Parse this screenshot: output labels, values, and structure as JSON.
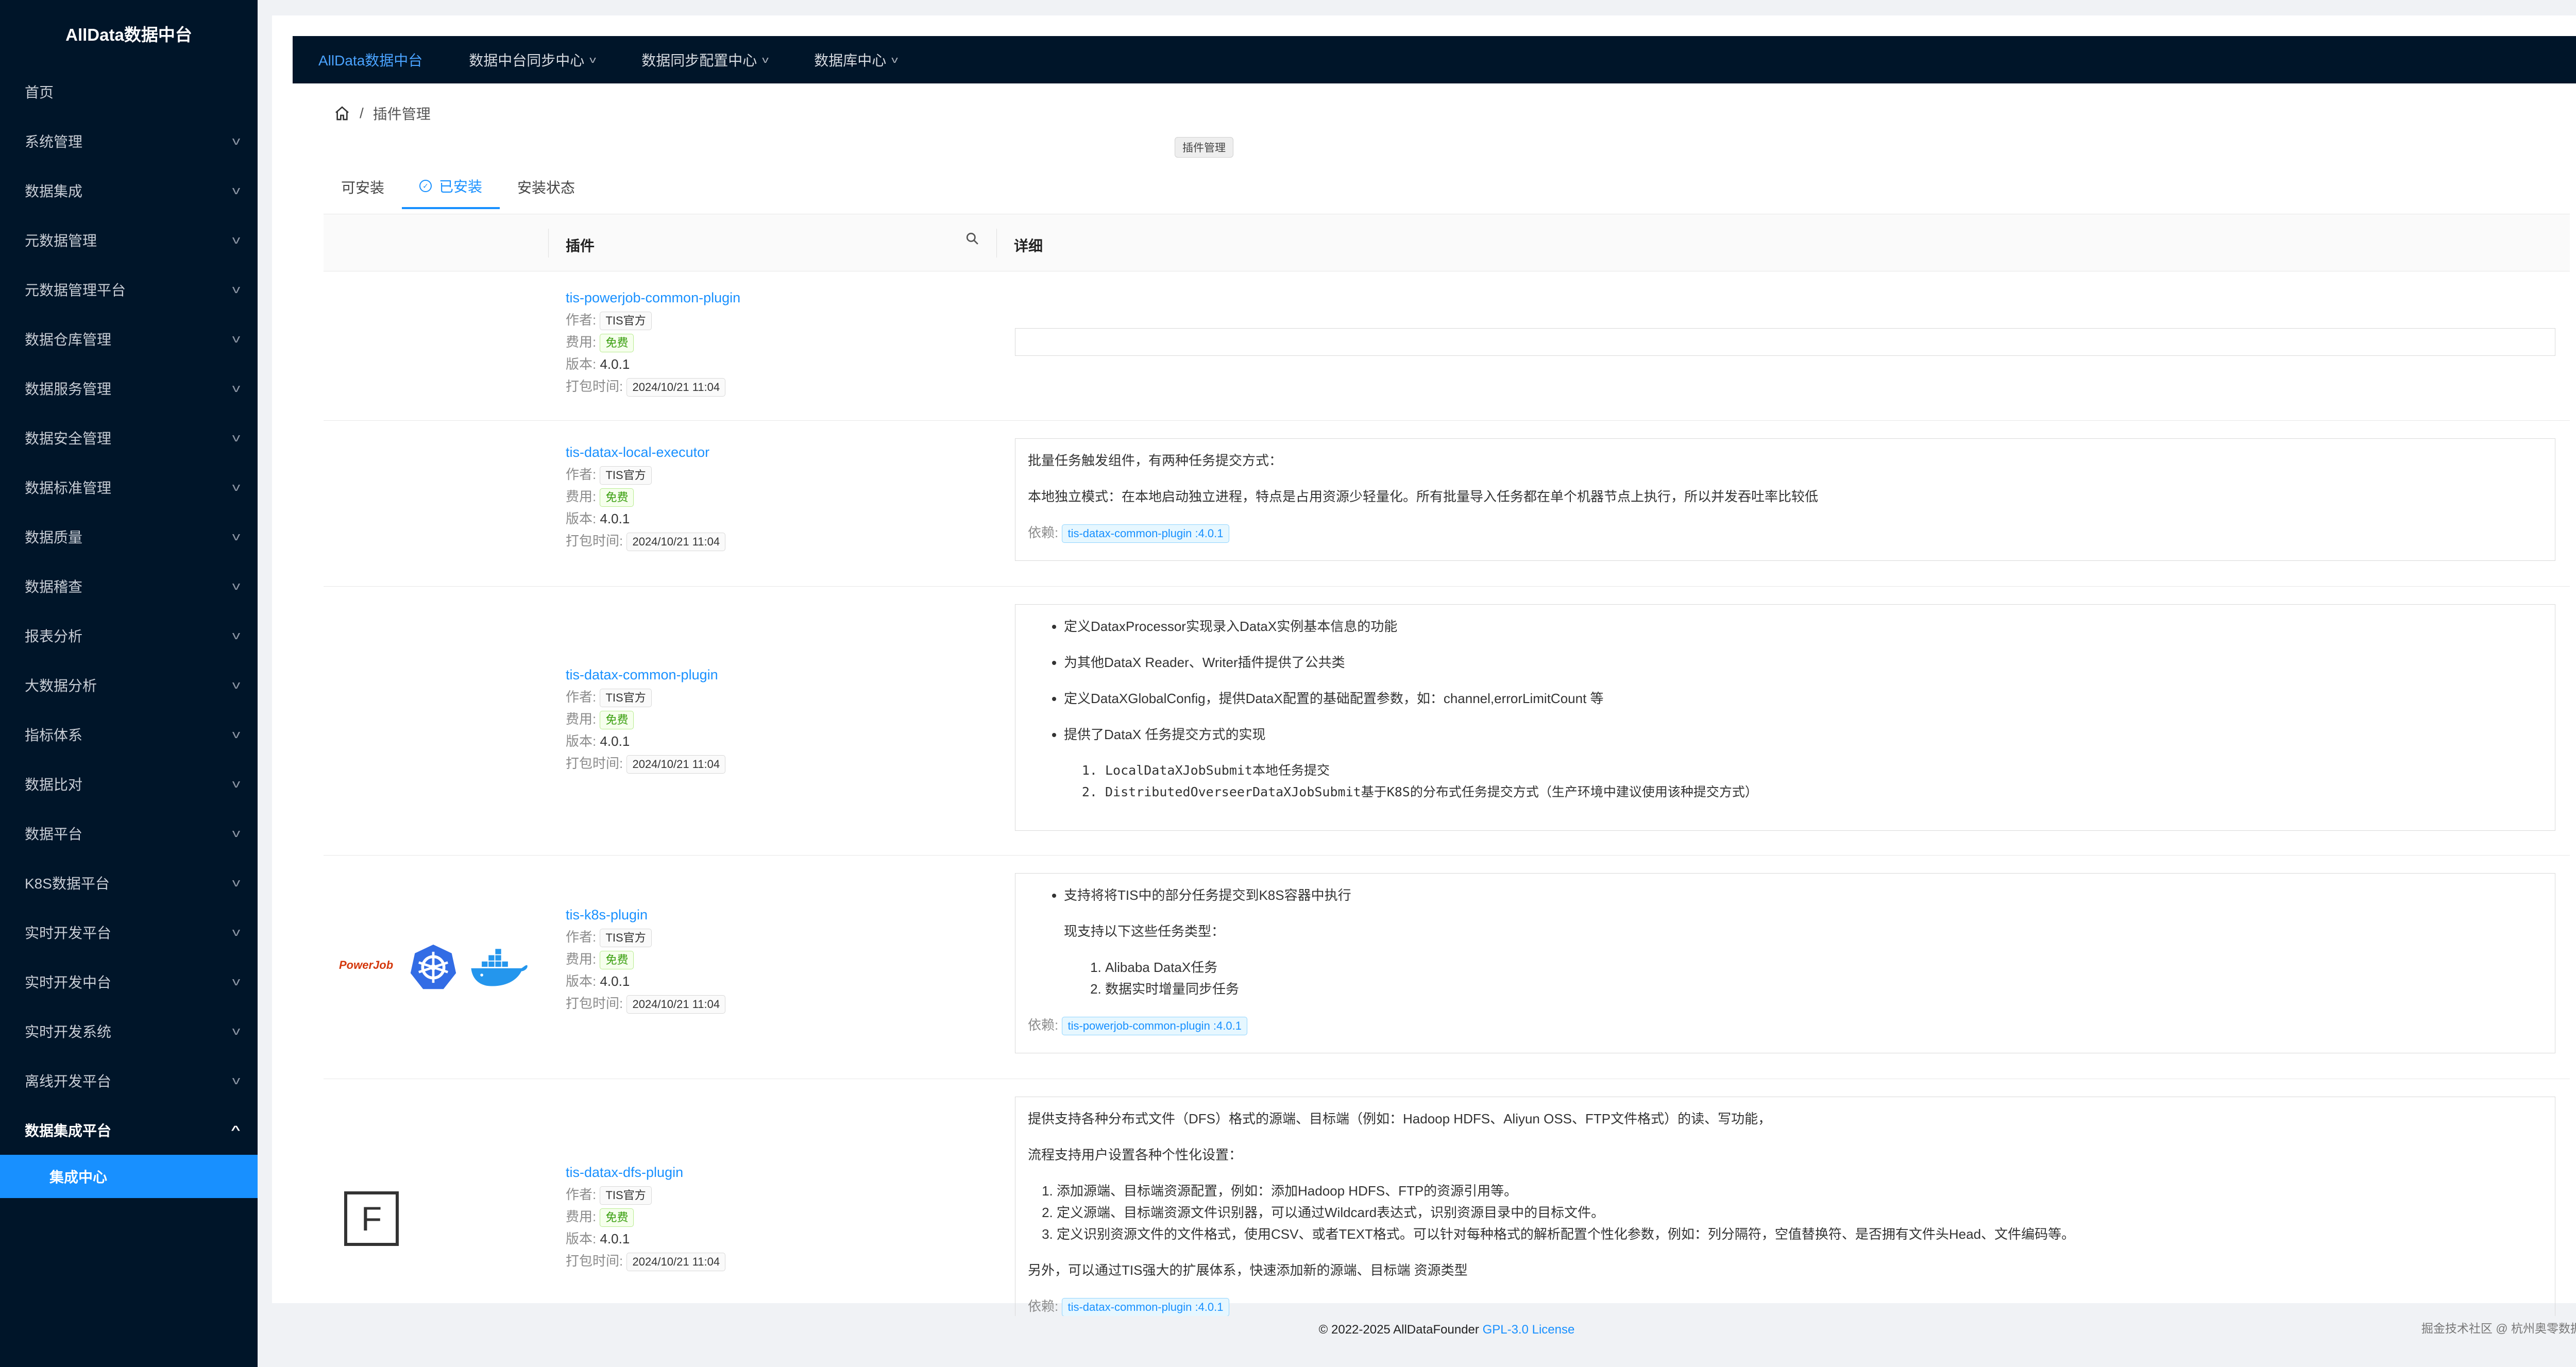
{
  "app_title": "AllData数据中台",
  "sidebar": {
    "items": [
      {
        "label": "首页",
        "chevron": false
      },
      {
        "label": "系统管理",
        "chevron": true
      },
      {
        "label": "数据集成",
        "chevron": true
      },
      {
        "label": "元数据管理",
        "chevron": true
      },
      {
        "label": "元数据管理平台",
        "chevron": true
      },
      {
        "label": "数据仓库管理",
        "chevron": true
      },
      {
        "label": "数据服务管理",
        "chevron": true
      },
      {
        "label": "数据安全管理",
        "chevron": true
      },
      {
        "label": "数据标准管理",
        "chevron": true
      },
      {
        "label": "数据质量",
        "chevron": true
      },
      {
        "label": "数据稽查",
        "chevron": true
      },
      {
        "label": "报表分析",
        "chevron": true
      },
      {
        "label": "大数据分析",
        "chevron": true
      },
      {
        "label": "指标体系",
        "chevron": true
      },
      {
        "label": "数据比对",
        "chevron": true
      },
      {
        "label": "数据平台",
        "chevron": true
      },
      {
        "label": "K8S数据平台",
        "chevron": true
      },
      {
        "label": "实时开发平台",
        "chevron": true
      },
      {
        "label": "实时开发中台",
        "chevron": true
      },
      {
        "label": "实时开发系统",
        "chevron": true
      },
      {
        "label": "离线开发平台",
        "chevron": true
      }
    ],
    "open_item": "数据集成平台",
    "active_subitem": "集成中心"
  },
  "topnav": {
    "items": [
      "AllData数据中台",
      "数据中台同步中心",
      "数据同步配置中心",
      "数据库中心"
    ]
  },
  "breadcrumb": {
    "current": "插件管理"
  },
  "tooltip": "插件管理",
  "tabs": [
    "可安装",
    "已安装",
    "安装状态"
  ],
  "table": {
    "col_plugin": "插件",
    "col_detail": "详细",
    "labels": {
      "author": "作者:",
      "fee": "费用:",
      "version": "版本:",
      "packaged": "打包时间:",
      "dependency": "依赖:"
    },
    "rows": [
      {
        "name": "tis-powerjob-common-plugin",
        "author": "TIS官方",
        "fee": "免费",
        "version": "4.0.1",
        "time": "2024/10/21 11:04"
      },
      {
        "name": "tis-datax-local-executor",
        "author": "TIS官方",
        "fee": "免费",
        "version": "4.0.1",
        "time": "2024/10/21 11:04",
        "detail": {
          "p1": "批量任务触发组件，有两种任务提交方式：",
          "p2": "本地独立模式：在本地启动独立进程，特点是占用资源少轻量化。所有批量导入任务都在单个机器节点上执行，所以并发吞吐率比较低",
          "dep": "tis-datax-common-plugin :4.0.1"
        }
      },
      {
        "name": "tis-datax-common-plugin",
        "author": "TIS官方",
        "fee": "免费",
        "version": "4.0.1",
        "time": "2024/10/21 11:04",
        "detail": {
          "bullets": [
            "定义DataxProcessor实现录入DataX实例基本信息的功能",
            "为其他DataX Reader、Writer插件提供了公共类",
            "定义DataXGlobalConfig，提供DataX配置的基础配置参数，如：channel,errorLimitCount 等",
            "提供了DataX 任务提交方式的实现"
          ],
          "ol": [
            "LocalDataXJobSubmit本地任务提交",
            "DistributedOverseerDataXJobSubmit基于K8S的分布式任务提交方式（生产环境中建议使用该种提交方式）"
          ]
        }
      },
      {
        "name": "tis-k8s-plugin",
        "author": "TIS官方",
        "fee": "免费",
        "version": "4.0.1",
        "time": "2024/10/21 11:04",
        "logos": {
          "powerjob": "PowerJob"
        },
        "detail": {
          "bullet": "支持将将TIS中的部分任务提交到K8S容器中执行",
          "sub": "现支持以下这些任务类型：",
          "ol": [
            "Alibaba DataX任务",
            "数据实时增量同步任务"
          ],
          "dep": "tis-powerjob-common-plugin :4.0.1"
        }
      },
      {
        "name": "tis-datax-dfs-plugin",
        "author": "TIS官方",
        "fee": "免费",
        "version": "4.0.1",
        "time": "2024/10/21 11:04",
        "logos": {
          "letter": "F"
        },
        "detail": {
          "p1": "提供支持各种分布式文件（DFS）格式的源端、目标端（例如：Hadoop HDFS、Aliyun OSS、FTP文件格式）的读、写功能，",
          "p2": "流程支持用户设置各种个性化设置：",
          "ol": [
            "添加源端、目标端资源配置，例如：添加Hadoop HDFS、FTP的资源引用等。",
            "定义源端、目标端资源文件识别器，可以通过Wildcard表达式，识别资源目录中的目标文件。",
            "定义识别资源文件的文件格式，使用CSV、或者TEXT格式。可以针对每种格式的解析配置个性化参数，例如：列分隔符，空值替换符、是否拥有文件头Head、文件编码等。"
          ],
          "p3": "另外，可以通过TIS强大的扩展体系，快速添加新的源端、目标端 资源类型",
          "dep": "tis-datax-common-plugin :4.0.1"
        }
      }
    ]
  },
  "footer": {
    "copyright": "© 2022-2025 AllDataFounder",
    "license": "GPL-3.0 License",
    "watermark": "掘金技术社区 @ 杭州奥零数据科技"
  },
  "colors": {
    "sidebar_bg": "#001529",
    "accent": "#1890ff",
    "free_tag": "#389e0d"
  }
}
